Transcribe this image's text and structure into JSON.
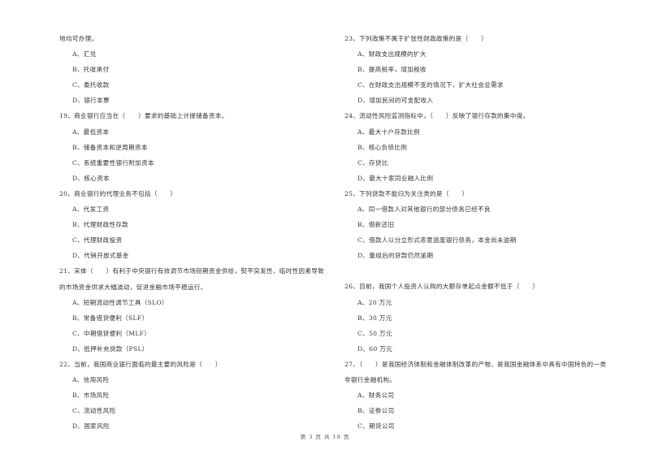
{
  "left_column": {
    "lines": [
      {
        "type": "text",
        "text": "地均可办理。"
      },
      {
        "type": "option",
        "text": "A、汇兑"
      },
      {
        "type": "option",
        "text": "B、托收承付"
      },
      {
        "type": "option",
        "text": "C、委托收款"
      },
      {
        "type": "option",
        "text": "D、银行本票"
      },
      {
        "type": "question",
        "text": "19、商业银行应当在（　　）要求的基础上计提储备资本。"
      },
      {
        "type": "option",
        "text": "A、最低资本"
      },
      {
        "type": "option",
        "text": "B、储备资本和逆周期资本"
      },
      {
        "type": "option",
        "text": "C、系统重要性银行附加资本"
      },
      {
        "type": "option",
        "text": "D、核心资本"
      },
      {
        "type": "question",
        "text": "20、商业银行的代理业务不包括（　　）"
      },
      {
        "type": "option",
        "text": "A、代发工资"
      },
      {
        "type": "option",
        "text": "B、代理财政性存款"
      },
      {
        "type": "option",
        "text": "C、代理财政投资"
      },
      {
        "type": "option",
        "text": "D、代销开放式基金"
      },
      {
        "type": "question",
        "text": "21、宋体（　　）有利于中央银行有效调节市场短期资金供给，熨平突发性、临时性因素导致"
      },
      {
        "type": "text",
        "text": "的市场资金供求大幅波动，促进金融市场平稳运行。"
      },
      {
        "type": "option",
        "text": "A、短期流动性调节工具（SLO）"
      },
      {
        "type": "option",
        "text": "B、常备借贷便利（SLF）"
      },
      {
        "type": "option",
        "text": "C、中期借贷便利（MLF）"
      },
      {
        "type": "option",
        "text": "D、抵押补充贷款（PSL）"
      },
      {
        "type": "question",
        "text": "22、当前，我国商业银行面临的最主要的风险是（　　）"
      },
      {
        "type": "option",
        "text": "A、信用风险"
      },
      {
        "type": "option",
        "text": "B、市场风险"
      },
      {
        "type": "option",
        "text": "C、流动性风险"
      },
      {
        "type": "option",
        "text": "D、国家风险"
      }
    ]
  },
  "right_column": {
    "lines": [
      {
        "type": "question",
        "text": "23、下列政策不属于扩张性财政政策的是（　　）"
      },
      {
        "type": "option",
        "text": "A、财政支出规模的扩大"
      },
      {
        "type": "option",
        "text": "B、提高税率，增加税收"
      },
      {
        "type": "option",
        "text": "C、在财政支出规模不变的情况下，扩大社会总需求"
      },
      {
        "type": "option",
        "text": "D、增加民间的可支配收入"
      },
      {
        "type": "question",
        "text": "24、流动性风险监测指标中，（　　）反映了银行存款的集中度。"
      },
      {
        "type": "option",
        "text": "A、最大十户存款比例"
      },
      {
        "type": "option",
        "text": "B、核心负债比例"
      },
      {
        "type": "option",
        "text": "C、存贷比"
      },
      {
        "type": "option",
        "text": "D、最大十家同业融入比例"
      },
      {
        "type": "question",
        "text": "25、下列贷款不能归为关注类的是（　　）"
      },
      {
        "type": "option",
        "text": "A、同一借款人对其他银行的部分债务已经不良"
      },
      {
        "type": "option",
        "text": "B、借新还旧"
      },
      {
        "type": "option",
        "text": "C、借款人以分立形式恶意逃废银行债务，本金尚未逾期"
      },
      {
        "type": "option",
        "text": "D、重组后的贷款仍然逾期"
      },
      {
        "type": "gap",
        "text": ""
      },
      {
        "type": "question",
        "text": "26、目前，我国个人投资人认购的大额存单起点金额不低于（　　）"
      },
      {
        "type": "option",
        "text": "A、20 万元"
      },
      {
        "type": "option",
        "text": "B、30 万元"
      },
      {
        "type": "option",
        "text": "C、50 万元"
      },
      {
        "type": "option",
        "text": "D、60 万元"
      },
      {
        "type": "question",
        "text": "27、（　　）是我国经济体制和金融体制改革的产物，是我国金融体系中具有中国特色的一类"
      },
      {
        "type": "text",
        "text": "非银行金融机构。"
      },
      {
        "type": "option",
        "text": "A、财务公司"
      },
      {
        "type": "option",
        "text": "B、证券公司"
      },
      {
        "type": "option",
        "text": "C、期货公司"
      }
    ]
  },
  "footer": {
    "page_label": "第 3 页 共 18 页"
  }
}
